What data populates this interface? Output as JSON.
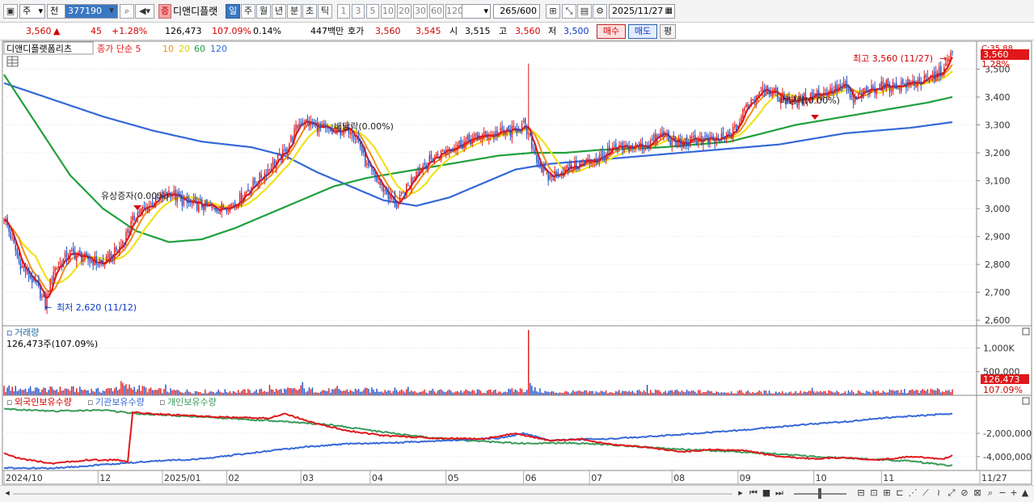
{
  "toolbar": {
    "period_type": "주",
    "prev_label": "전",
    "stock_code": "377190",
    "stock_flag": "증",
    "stock_name": "디앤디플랫",
    "period_tabs": [
      "일",
      "주",
      "월",
      "년",
      "분",
      "초",
      "틱"
    ],
    "active_period": "일",
    "interval_tabs": [
      "1",
      "3",
      "5",
      "10",
      "20",
      "30",
      "60",
      "120"
    ],
    "count_value": "265",
    "count_total": "/600",
    "date_value": "2025/11/27"
  },
  "quote": {
    "price": "3,560",
    "change_arrow": "▲",
    "change": "45",
    "change_pct": "+1.28%",
    "volume": "126,473",
    "volume_ratio": "107.09%",
    "turnover": "0.14%",
    "amount": "447백만",
    "bid_label": "호가",
    "ask_price": "3,560",
    "bid_price": "3,545",
    "open_label": "시",
    "open": "3,515",
    "high_label": "고",
    "high": "3,560",
    "low_label": "저",
    "low": "3,500",
    "buy_label": "매수",
    "sell_label": "매도",
    "eval_label": "평"
  },
  "colors": {
    "candle_up": "#e21b1b",
    "candle_down": "#1f4fc8",
    "ma5": "#e0171b",
    "ma10": "#f08c1c",
    "ma20": "#f2e11c",
    "ma60": "#20a03c",
    "ma120": "#3568d8",
    "foreign": "#e0171b",
    "institution": "#3568d8",
    "individual": "#3a9a5a"
  },
  "chart_data": [
    {
      "type": "line",
      "title": "디앤디플랫폼리츠",
      "legend": [
        "종가 단순 5",
        "10",
        "20",
        "60",
        "120"
      ],
      "ylim": [
        2580,
        3600
      ],
      "y_ticks": [
        2600,
        2700,
        2800,
        2900,
        3000,
        3100,
        3200,
        3300,
        3400,
        3500
      ],
      "y_tick_labels": [
        "2,600",
        "2,700",
        "2,800",
        "2,900",
        "3,000",
        "3,100",
        "3,200",
        "3,300",
        "3,400",
        "3,500"
      ],
      "x_labels": [
        "2024/10",
        "12",
        "2025/01",
        "02",
        "03",
        "04",
        "05",
        "06",
        "07",
        "08",
        "09",
        "10",
        "11",
        "11/27"
      ],
      "x_label_pos": [
        0,
        57,
        96,
        135,
        180,
        222,
        268,
        315,
        355,
        405,
        445,
        491,
        532,
        591
      ],
      "current_price_label": "3,560",
      "change_pct_label": "1.28%",
      "top_right_label": "C:35.88",
      "annotations": {
        "high": "최고 3,560 (11/27)",
        "low": "최저 2,620 (11/12)",
        "event_rights": "유상증자(0.00%)",
        "event_dividend1": "배당락(0.00%)",
        "event_dividend2": "배당락(0.00%)"
      },
      "close_anchors": [
        [
          0,
          2970
        ],
        [
          10,
          2800
        ],
        [
          20,
          2720
        ],
        [
          25,
          2660
        ],
        [
          30,
          2780
        ],
        [
          40,
          2840
        ],
        [
          50,
          2820
        ],
        [
          60,
          2800
        ],
        [
          70,
          2860
        ],
        [
          80,
          2980
        ],
        [
          90,
          3020
        ],
        [
          100,
          3060
        ],
        [
          110,
          3020
        ],
        [
          120,
          3010
        ],
        [
          130,
          3000
        ],
        [
          140,
          3020
        ],
        [
          150,
          3080
        ],
        [
          160,
          3140
        ],
        [
          170,
          3200
        ],
        [
          180,
          3320
        ],
        [
          190,
          3290
        ],
        [
          200,
          3270
        ],
        [
          210,
          3290
        ],
        [
          215,
          3240
        ],
        [
          220,
          3150
        ],
        [
          230,
          3070
        ],
        [
          238,
          3010
        ],
        [
          245,
          3080
        ],
        [
          250,
          3140
        ],
        [
          260,
          3180
        ],
        [
          270,
          3220
        ],
        [
          280,
          3240
        ],
        [
          290,
          3260
        ],
        [
          300,
          3270
        ],
        [
          310,
          3280
        ],
        [
          315,
          3300
        ],
        [
          320,
          3230
        ],
        [
          325,
          3150
        ],
        [
          330,
          3110
        ],
        [
          340,
          3140
        ],
        [
          350,
          3160
        ],
        [
          360,
          3180
        ],
        [
          370,
          3210
        ],
        [
          380,
          3220
        ],
        [
          390,
          3230
        ],
        [
          395,
          3250
        ],
        [
          400,
          3270
        ],
        [
          405,
          3240
        ],
        [
          410,
          3230
        ],
        [
          420,
          3250
        ],
        [
          430,
          3240
        ],
        [
          440,
          3260
        ],
        [
          445,
          3300
        ],
        [
          450,
          3370
        ],
        [
          455,
          3400
        ],
        [
          460,
          3440
        ],
        [
          470,
          3400
        ],
        [
          480,
          3380
        ],
        [
          490,
          3410
        ],
        [
          500,
          3420
        ],
        [
          510,
          3440
        ],
        [
          515,
          3380
        ],
        [
          520,
          3410
        ],
        [
          530,
          3440
        ],
        [
          540,
          3440
        ],
        [
          550,
          3450
        ],
        [
          560,
          3460
        ],
        [
          570,
          3500
        ],
        [
          575,
          3560
        ]
      ],
      "ma60_anchors": [
        [
          0,
          3480
        ],
        [
          20,
          3300
        ],
        [
          40,
          3120
        ],
        [
          60,
          3000
        ],
        [
          80,
          2920
        ],
        [
          100,
          2880
        ],
        [
          120,
          2890
        ],
        [
          140,
          2930
        ],
        [
          160,
          2980
        ],
        [
          180,
          3030
        ],
        [
          200,
          3080
        ],
        [
          220,
          3110
        ],
        [
          240,
          3130
        ],
        [
          260,
          3150
        ],
        [
          280,
          3170
        ],
        [
          300,
          3190
        ],
        [
          320,
          3200
        ],
        [
          340,
          3200
        ],
        [
          360,
          3210
        ],
        [
          380,
          3215
        ],
        [
          400,
          3220
        ],
        [
          420,
          3230
        ],
        [
          440,
          3240
        ],
        [
          460,
          3270
        ],
        [
          480,
          3300
        ],
        [
          500,
          3320
        ],
        [
          520,
          3340
        ],
        [
          540,
          3360
        ],
        [
          560,
          3380
        ],
        [
          575,
          3400
        ]
      ],
      "ma120_anchors": [
        [
          0,
          3450
        ],
        [
          30,
          3390
        ],
        [
          60,
          3330
        ],
        [
          90,
          3280
        ],
        [
          120,
          3240
        ],
        [
          150,
          3220
        ],
        [
          170,
          3190
        ],
        [
          190,
          3130
        ],
        [
          210,
          3080
        ],
        [
          230,
          3030
        ],
        [
          250,
          3010
        ],
        [
          270,
          3040
        ],
        [
          290,
          3090
        ],
        [
          310,
          3140
        ],
        [
          330,
          3160
        ],
        [
          350,
          3170
        ],
        [
          370,
          3180
        ],
        [
          390,
          3190
        ],
        [
          410,
          3200
        ],
        [
          430,
          3210
        ],
        [
          450,
          3220
        ],
        [
          470,
          3230
        ],
        [
          490,
          3250
        ],
        [
          510,
          3270
        ],
        [
          530,
          3280
        ],
        [
          550,
          3290
        ],
        [
          575,
          3310
        ]
      ]
    },
    {
      "type": "bar",
      "title": "거래량",
      "value_label": "126,473주(107.09%)",
      "ylim": [
        0,
        1400000
      ],
      "y_ticks": [
        500000,
        1000000
      ],
      "y_tick_labels": [
        "500,000",
        "1,000K"
      ],
      "last_value_label": "126,473",
      "last_ratio_label": "107.09%",
      "volume_anchors": [
        [
          0,
          180000
        ],
        [
          20,
          150000
        ],
        [
          40,
          160000
        ],
        [
          60,
          120000
        ],
        [
          70,
          220000
        ],
        [
          80,
          200000
        ],
        [
          90,
          130000
        ],
        [
          120,
          100000
        ],
        [
          150,
          110000
        ],
        [
          180,
          150000
        ],
        [
          200,
          120000
        ],
        [
          230,
          140000
        ],
        [
          260,
          110000
        ],
        [
          300,
          100000
        ],
        [
          320,
          160000
        ],
        [
          330,
          80000
        ],
        [
          360,
          90000
        ],
        [
          400,
          100000
        ],
        [
          440,
          90000
        ],
        [
          480,
          80000
        ],
        [
          520,
          90000
        ],
        [
          575,
          126473
        ]
      ],
      "volume_spikes": [
        [
          71,
          300000
        ],
        [
          72,
          260000
        ],
        [
          85,
          190000
        ],
        [
          98,
          230000
        ],
        [
          161,
          220000
        ],
        [
          180,
          210000
        ],
        [
          181,
          280000
        ],
        [
          202,
          200000
        ],
        [
          245,
          180000
        ],
        [
          318,
          1380000
        ],
        [
          319,
          260000
        ],
        [
          320,
          200000
        ],
        [
          390,
          220000
        ],
        [
          490,
          160000
        ],
        [
          560,
          130000
        ]
      ]
    },
    {
      "type": "line",
      "title": "외국인보유수량",
      "series": [
        {
          "name": "외국인보유수량"
        },
        {
          "name": "기관보유수량"
        },
        {
          "name": "개인보유수량"
        }
      ],
      "ylim": [
        -5200000,
        300000
      ],
      "y_ticks": [
        -2000000,
        -4000000
      ],
      "y_tick_labels": [
        "-2,000,000",
        "-4,000,000"
      ],
      "foreign_anchors": [
        [
          0,
          -3700000
        ],
        [
          10,
          -4200000
        ],
        [
          30,
          -4600000
        ],
        [
          50,
          -4300000
        ],
        [
          70,
          -4300000
        ],
        [
          75,
          -4500000
        ],
        [
          78,
          -200000
        ],
        [
          100,
          -400000
        ],
        [
          130,
          -600000
        ],
        [
          160,
          -700000
        ],
        [
          170,
          -300000
        ],
        [
          190,
          -1200000
        ],
        [
          210,
          -1800000
        ],
        [
          230,
          -2200000
        ],
        [
          260,
          -2400000
        ],
        [
          290,
          -2500000
        ],
        [
          310,
          -2000000
        ],
        [
          330,
          -2600000
        ],
        [
          350,
          -2500000
        ],
        [
          370,
          -3000000
        ],
        [
          390,
          -3200000
        ],
        [
          410,
          -3600000
        ],
        [
          430,
          -3400000
        ],
        [
          450,
          -3500000
        ],
        [
          470,
          -4000000
        ],
        [
          490,
          -4200000
        ],
        [
          510,
          -4100000
        ],
        [
          530,
          -4300000
        ],
        [
          550,
          -4000000
        ],
        [
          570,
          -4200000
        ],
        [
          575,
          -3900000
        ]
      ],
      "institution_anchors": [
        [
          0,
          -5000000
        ],
        [
          30,
          -5000000
        ],
        [
          60,
          -4700000
        ],
        [
          90,
          -4400000
        ],
        [
          120,
          -4200000
        ],
        [
          150,
          -3700000
        ],
        [
          180,
          -3200000
        ],
        [
          210,
          -2900000
        ],
        [
          240,
          -2800000
        ],
        [
          270,
          -2600000
        ],
        [
          300,
          -2400000
        ],
        [
          315,
          -2000000
        ],
        [
          330,
          -2600000
        ],
        [
          360,
          -2500000
        ],
        [
          390,
          -2300000
        ],
        [
          420,
          -2000000
        ],
        [
          450,
          -1700000
        ],
        [
          480,
          -1300000
        ],
        [
          510,
          -1000000
        ],
        [
          540,
          -600000
        ],
        [
          575,
          -300000
        ]
      ],
      "individual_anchors": [
        [
          0,
          100000
        ],
        [
          30,
          -100000
        ],
        [
          60,
          0
        ],
        [
          80,
          -300000
        ],
        [
          120,
          -600000
        ],
        [
          160,
          -900000
        ],
        [
          200,
          -1300000
        ],
        [
          230,
          -1900000
        ],
        [
          260,
          -2400000
        ],
        [
          290,
          -2700000
        ],
        [
          320,
          -2900000
        ],
        [
          340,
          -2800000
        ],
        [
          370,
          -3000000
        ],
        [
          400,
          -3300000
        ],
        [
          430,
          -3500000
        ],
        [
          460,
          -3700000
        ],
        [
          490,
          -4000000
        ],
        [
          520,
          -4200000
        ],
        [
          550,
          -4400000
        ],
        [
          575,
          -4800000
        ]
      ]
    }
  ],
  "bottom": {
    "zoom_label": "Q",
    "status": ""
  }
}
